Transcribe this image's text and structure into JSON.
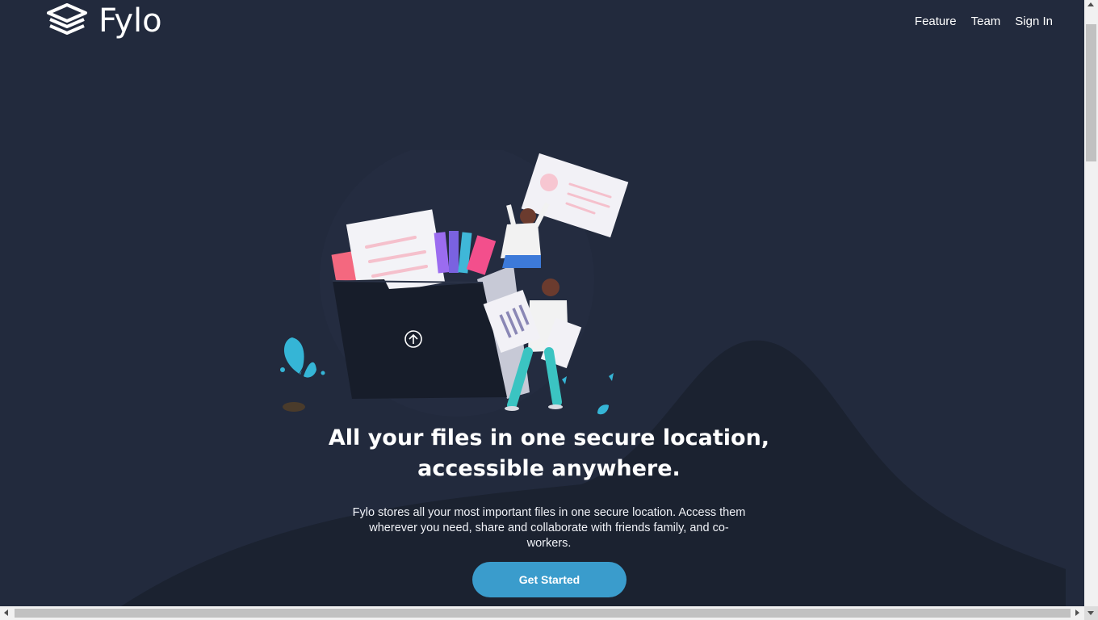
{
  "brand": {
    "name": "Fylo",
    "logo_icon": "stacked-layers-icon"
  },
  "nav": {
    "items": [
      {
        "label": "Feature"
      },
      {
        "label": "Team"
      },
      {
        "label": "Sign In"
      }
    ]
  },
  "hero": {
    "title": "All your files in one secure location, accessible anywhere.",
    "description": "Fylo stores all your most important files in one secure location. Access them wherever you need, share and collaborate with friends family, and co-workers.",
    "cta_label": "Get Started",
    "illustration_icon": "upload-arrow-icon"
  },
  "colors": {
    "background": "#222a3d",
    "curve": "#1b2230",
    "accent": "#3a9ccc",
    "text": "#ffffff"
  }
}
